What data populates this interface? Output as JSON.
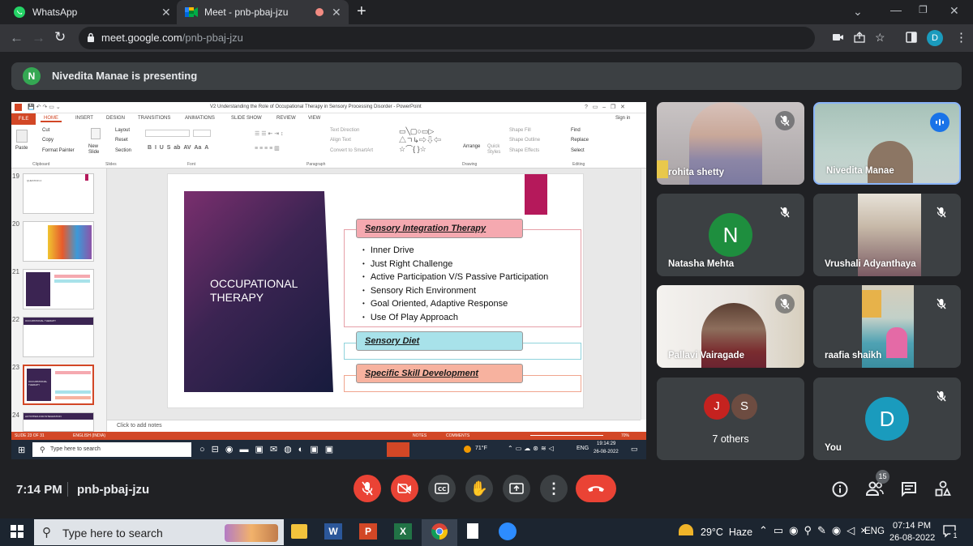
{
  "browser": {
    "tabs": [
      {
        "title": "WhatsApp"
      },
      {
        "title": "Meet - pnb-pbaj-jzu"
      }
    ],
    "url_host": "meet.google.com",
    "url_path": "/pnb-pbaj-jzu",
    "profile_initial": "D"
  },
  "presenting_banner": {
    "avatar_initial": "N",
    "text": "Nivedita Manae is presenting"
  },
  "powerpoint": {
    "window_title": "V2 Understanding the Role of Occupational Therapy in Sensory Processing Disorder - PowerPoint",
    "signin": "Sign in",
    "ribbon_tabs": [
      "FILE",
      "HOME",
      "INSERT",
      "DESIGN",
      "TRANSITIONS",
      "ANIMATIONS",
      "SLIDE SHOW",
      "REVIEW",
      "VIEW"
    ],
    "ribbon_groups": [
      "Clipboard",
      "Slides",
      "Font",
      "Paragraph",
      "Drawing",
      "Editing"
    ],
    "clipboard_items": [
      "Cut",
      "Copy",
      "Format Painter"
    ],
    "paste_label": "Paste",
    "new_slide_label": "New Slide",
    "slides_items": [
      "Layout",
      "Reset",
      "Section"
    ],
    "paragraph_items": [
      "Text Direction",
      "Align Text",
      "Convert to SmartArt"
    ],
    "drawing_items": [
      "Shape Fill",
      "Shape Outline",
      "Shape Effects"
    ],
    "arrange_label": "Arrange",
    "quick_styles_label": "Quick Styles",
    "editing_items": [
      "Find",
      "Replace",
      "Select"
    ],
    "thumbnails": [
      {
        "num": "19",
        "text": "QUESTION 4"
      },
      {
        "num": "20",
        "text": ""
      },
      {
        "num": "21",
        "text": ""
      },
      {
        "num": "22",
        "text": "OCCUPATIONAL THERAPY"
      },
      {
        "num": "23",
        "text": "OCCUPATIONAL THERAPY"
      },
      {
        "num": "24",
        "text": "ACTIVITIES FOR INTEGRATION"
      }
    ],
    "slide": {
      "title": "OCCUPATIONAL THERAPY",
      "header1": "Sensory Integration Therapy",
      "bullets": [
        "Inner Drive",
        "Just Right Challenge",
        "Active Participation V/S Passive Participation",
        "Sensory Rich Environment",
        "Goal Oriented, Adaptive Response",
        "Use Of Play Approach"
      ],
      "header2": "Sensory Diet",
      "header3": "Specific Skill Development"
    },
    "notes_placeholder": "Click to add notes",
    "status_slide": "SLIDE 23 OF 31",
    "status_lang": "ENGLISH (INDIA)",
    "status_notes": "NOTES",
    "status_comments": "COMMENTS",
    "zoom": "70%",
    "taskbar": {
      "search_placeholder": "Type here to search",
      "weather": "71°F",
      "lang": "ENG",
      "time": "19:14:29",
      "date": "26-08-2022"
    }
  },
  "participants": [
    {
      "name": "rohita shetty",
      "muted": true,
      "type": "video"
    },
    {
      "name": "Nivedita Manae",
      "muted": false,
      "speaking": true,
      "type": "video"
    },
    {
      "name": "Natasha Mehta",
      "initial": "N",
      "avatar_color": "#1e8e3e",
      "muted": true,
      "type": "avatar"
    },
    {
      "name": "Vrushali Adyanthaya",
      "muted": true,
      "type": "video"
    },
    {
      "name": "Pallavi Vairagade",
      "muted": true,
      "type": "video"
    },
    {
      "name": "raafia shaikh",
      "muted": true,
      "type": "video"
    },
    {
      "name": "7 others",
      "initials": [
        "J",
        "S"
      ],
      "type": "group"
    },
    {
      "name": "You",
      "initial": "D",
      "avatar_color": "#1a9bbd",
      "muted": true,
      "type": "avatar"
    }
  ],
  "meeting": {
    "time": "7:14 PM",
    "code": "pnb-pbaj-jzu",
    "people_count": "15"
  },
  "colors": {
    "end_call": "#ea4335",
    "mic_off": "#ea4335",
    "powerpoint_accent": "#d24726",
    "header1_fill": "#f5a9b0",
    "header2_fill": "#a8e2ea",
    "header3_fill": "#f7b29f"
  },
  "taskbar": {
    "search_placeholder": "Type here to search",
    "weather": "29°C  Haze",
    "lang": "ENG",
    "time": "07:14 PM",
    "date": "26-08-2022",
    "notification_count": "1"
  }
}
